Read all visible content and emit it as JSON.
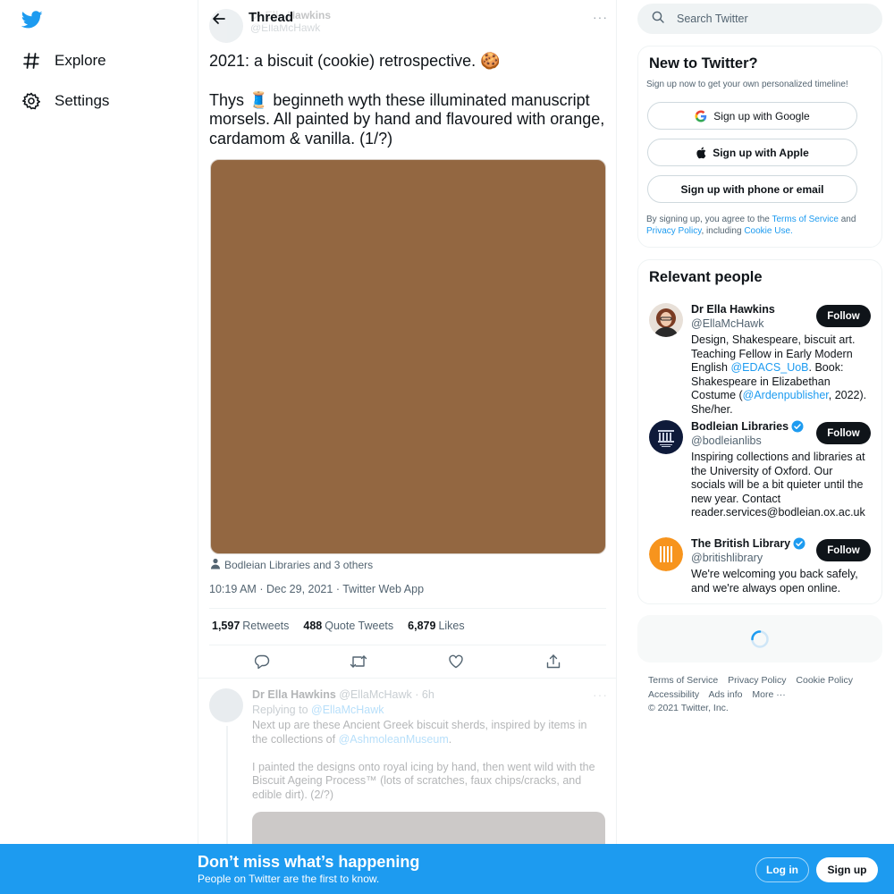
{
  "nav": {
    "explore": "Explore",
    "settings": "Settings"
  },
  "thread": {
    "title": "Thread",
    "faded_author_name": "Dr Ella Hawkins",
    "faded_author_handle": "@EllaMcHawk",
    "tweet_line1": "2021: a biscuit (cookie) retrospective. 🍪",
    "tweet_line2": "Thys 🧵 beginneth wyth these illuminated manuscript morsels. All painted by hand and flavoured with orange, cardamom & vanilla. (1/?)",
    "tagged": "Bodleian Libraries and 3 others",
    "time": "10:19 AM",
    "date": "Dec 29, 2021",
    "source": "Twitter Web App",
    "sep": "·",
    "stats": {
      "retweets_count": "1,597",
      "retweets_label": "Retweets",
      "quotes_count": "488",
      "quotes_label": "Quote Tweets",
      "likes_count": "6,879",
      "likes_label": "Likes"
    }
  },
  "reply": {
    "name": "Dr Ella Hawkins",
    "handle": "@EllaMcHawk",
    "time": "6h",
    "replying_to_label": "Replying to",
    "replying_to_handle": "@EllaMcHawk",
    "body1_pre": "Next up are these Ancient Greek biscuit sherds, inspired by items in the collections of",
    "body1_link": "@AshmoleanMuseum",
    "body1_post": ".",
    "body2": "I painted the designs onto royal icing by hand, then went wild with the Biscuit Ageing Process™ (lots of scratches, faux chips/cracks, and edible dirt). (2/?)"
  },
  "search": {
    "placeholder": "Search Twitter"
  },
  "signup_panel": {
    "title": "New to Twitter?",
    "subtitle": "Sign up now to get your own personalized timeline!",
    "google": "Sign up with Google",
    "apple": "Sign up with Apple",
    "phone": "Sign up with phone or email",
    "legal_pre": "By signing up, you agree to the",
    "terms": "Terms of Service",
    "and": "and",
    "privacy": "Privacy Policy",
    "including": ", including",
    "cookie": "Cookie Use."
  },
  "relevant": {
    "title": "Relevant people",
    "follow_label": "Follow",
    "people": [
      {
        "name": "Dr Ella Hawkins",
        "handle": "@EllaMcHawk",
        "bio_1": "Design, Shakespeare, biscuit art. Teaching Fellow in Early Modern English ",
        "bio_link1": "@EDACS_UoB",
        "bio_2": ". Book: Shakespeare in Elizabethan Costume (",
        "bio_link2": "@Ardenpublisher",
        "bio_3": ", 2022). She/her."
      },
      {
        "name": "Bodleian Libraries",
        "handle": "@bodleianlibs",
        "bio": "Inspiring collections and libraries at the University of Oxford. Our socials will be a bit quieter until the new year. Contact reader.services@bodleian.ox.ac.uk"
      },
      {
        "name": "The British Library",
        "handle": "@britishlibrary",
        "bio": "We're welcoming you back safely, and we're always open online."
      }
    ]
  },
  "footer": {
    "terms": "Terms of Service",
    "privacy": "Privacy Policy",
    "cookie": "Cookie Policy",
    "accessibility": "Accessibility",
    "ads": "Ads info",
    "more": "More ···",
    "copyright": "© 2021 Twitter, Inc."
  },
  "bottom_bar": {
    "title": "Don’t miss what’s happening",
    "subtitle": "People on Twitter are the first to know.",
    "login": "Log in",
    "signup": "Sign up"
  },
  "colors": {
    "brand": "#1d9bf0",
    "text": "#0f1419",
    "muted": "#536471",
    "image_placeholder": "#936741"
  }
}
